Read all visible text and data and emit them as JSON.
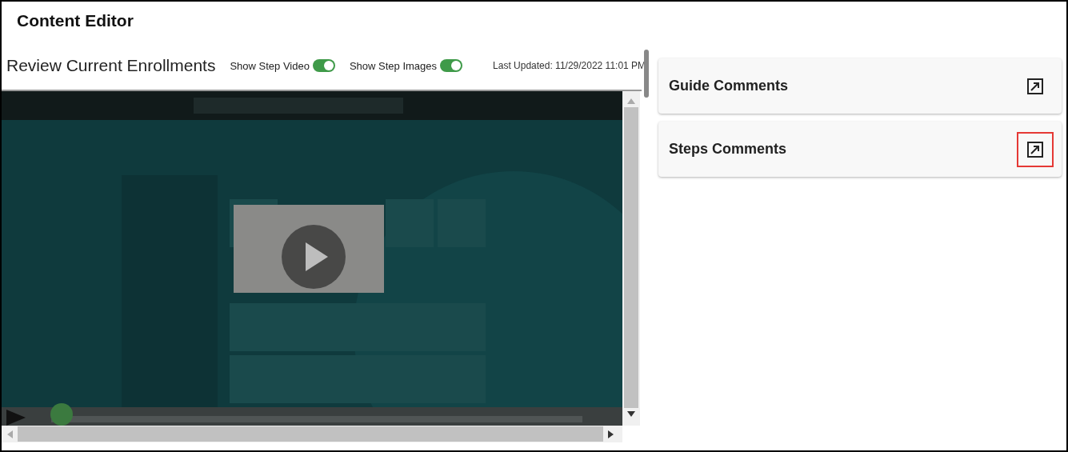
{
  "window": {
    "title": "Content Editor"
  },
  "guide": {
    "title": "Review Current Enrollments",
    "toggles": [
      {
        "label": "Show Step Video",
        "on": true
      },
      {
        "label": "Show Step Images",
        "on": true
      }
    ],
    "last_updated": "Last Updated: 11/29/2022 11:01 PM"
  },
  "video": {
    "kind": "picture",
    "playback": {
      "level": 0.02
    }
  },
  "panels": [
    {
      "title": "Guide Comments",
      "highlighted": false
    },
    {
      "title": "Steps Comments",
      "highlighted": true
    }
  ]
}
